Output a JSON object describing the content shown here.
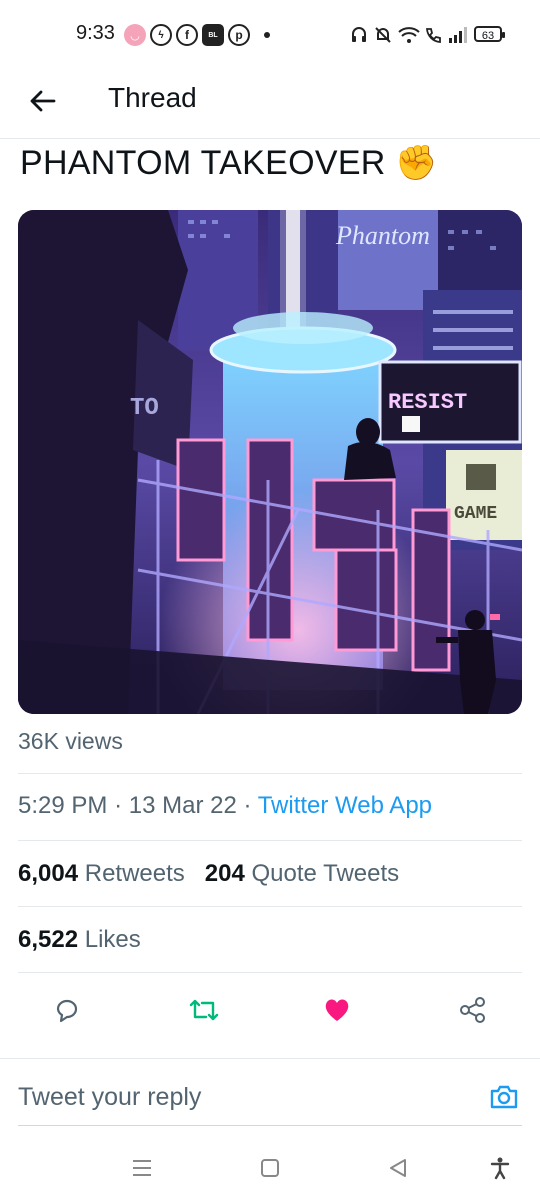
{
  "status_bar": {
    "time": "9:33",
    "battery": "63"
  },
  "header": {
    "title": "Thread"
  },
  "tweet": {
    "text": "PHANTOM TAKEOVER",
    "emoji": "✊",
    "views": "36K views",
    "time": "5:29 PM",
    "date": "13 Mar 22",
    "source": "Twitter Web App",
    "separator": "·",
    "retweets_count": "6,004",
    "retweets_label": "Retweets",
    "quotes_count": "204",
    "quotes_label": "Quote Tweets",
    "likes_count": "6,522",
    "likes_label": "Likes"
  },
  "image": {
    "resist_text": "RESIST",
    "phantom_text": "Phantom",
    "game_text": "GAME"
  },
  "reply": {
    "placeholder": "Tweet your reply"
  },
  "colors": {
    "accent": "#1d9bf0",
    "retweet": "#00ba7c",
    "like": "#f91880"
  }
}
